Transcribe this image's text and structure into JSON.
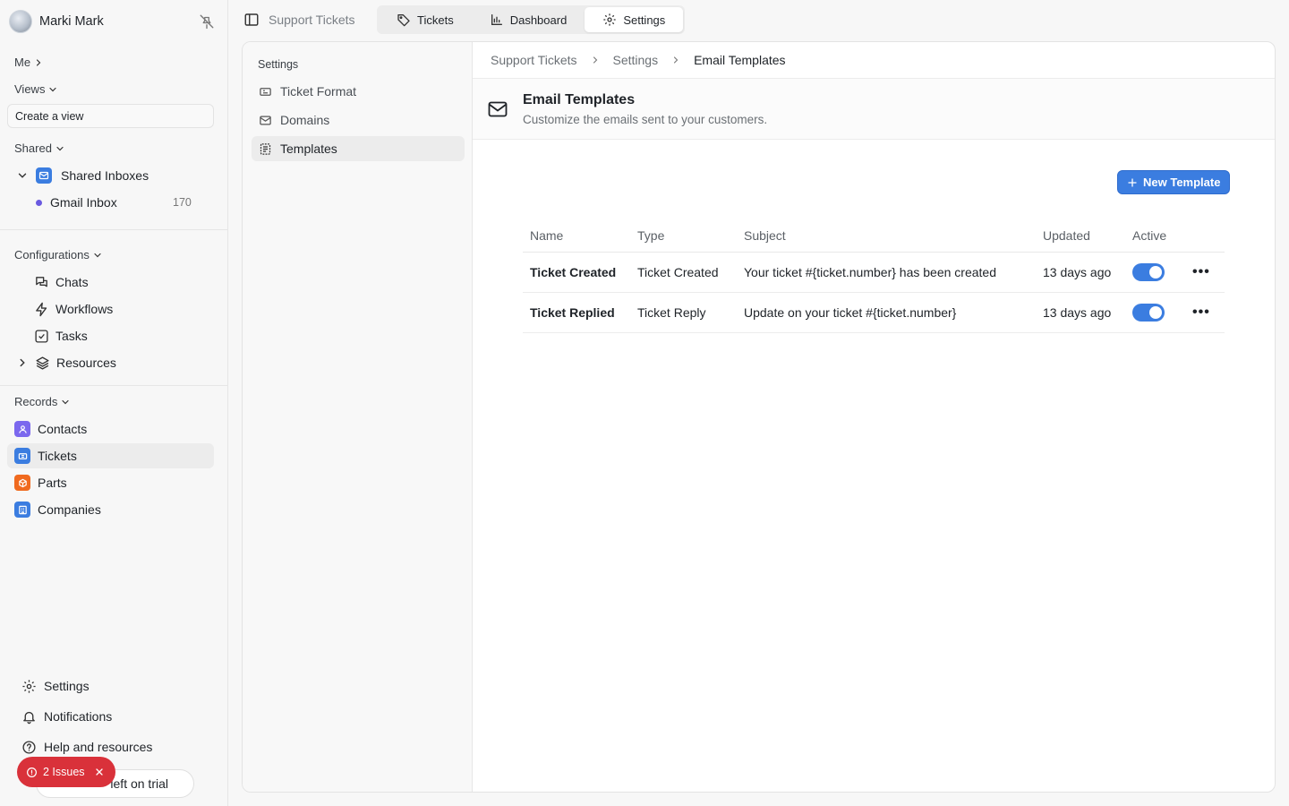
{
  "user": {
    "name": "Marki Mark"
  },
  "sidebar": {
    "me_label": "Me",
    "views_label": "Views",
    "create_view": "Create a view",
    "shared_label": "Shared",
    "shared_inboxes": {
      "label": "Shared Inboxes",
      "inbox": {
        "label": "Gmail Inbox",
        "count": "170"
      }
    },
    "configurations_label": "Configurations",
    "configurations": [
      {
        "label": "Chats",
        "icon": "chats-icon"
      },
      {
        "label": "Workflows",
        "icon": "workflows-icon"
      },
      {
        "label": "Tasks",
        "icon": "tasks-icon"
      },
      {
        "label": "Resources",
        "icon": "resources-icon"
      }
    ],
    "records_label": "Records",
    "records": [
      {
        "label": "Contacts",
        "color": "#7b68ee"
      },
      {
        "label": "Tickets",
        "color": "#3b7de0"
      },
      {
        "label": "Parts",
        "color": "#f06a1f"
      },
      {
        "label": "Companies",
        "color": "#3b7de0"
      }
    ],
    "footer": [
      {
        "label": "Settings",
        "icon": "gear-icon"
      },
      {
        "label": "Notifications",
        "icon": "bell-icon"
      },
      {
        "label": "Help and resources",
        "icon": "help-icon"
      }
    ],
    "issues": "2 Issues",
    "trial": "left on trial"
  },
  "topbar": {
    "title": "Support Tickets",
    "tabs": [
      {
        "label": "Tickets",
        "icon": "tag-icon",
        "active": false
      },
      {
        "label": "Dashboard",
        "icon": "chart-icon",
        "active": false
      },
      {
        "label": "Settings",
        "icon": "gear-icon",
        "active": true
      }
    ]
  },
  "settings_nav": {
    "title": "Settings",
    "items": [
      {
        "label": "Ticket Format",
        "active": false
      },
      {
        "label": "Domains",
        "active": false
      },
      {
        "label": "Templates",
        "active": true
      }
    ]
  },
  "breadcrumb": [
    "Support Tickets",
    "Settings",
    "Email Templates"
  ],
  "page": {
    "title": "Email Templates",
    "subtitle": "Customize the emails sent to your customers.",
    "new_button": "New Template"
  },
  "table": {
    "headers": [
      "Name",
      "Type",
      "Subject",
      "Updated",
      "Active"
    ],
    "rows": [
      {
        "name": "Ticket Created",
        "type": "Ticket Created",
        "subject": "Your ticket #{ticket.number} has been created",
        "updated": "13 days ago",
        "active": true
      },
      {
        "name": "Ticket Replied",
        "type": "Ticket Reply",
        "subject": "Update on your ticket #{ticket.number}",
        "updated": "13 days ago",
        "active": true
      }
    ]
  },
  "colors": {
    "accent": "#3b7de0",
    "danger": "#d9313a"
  }
}
